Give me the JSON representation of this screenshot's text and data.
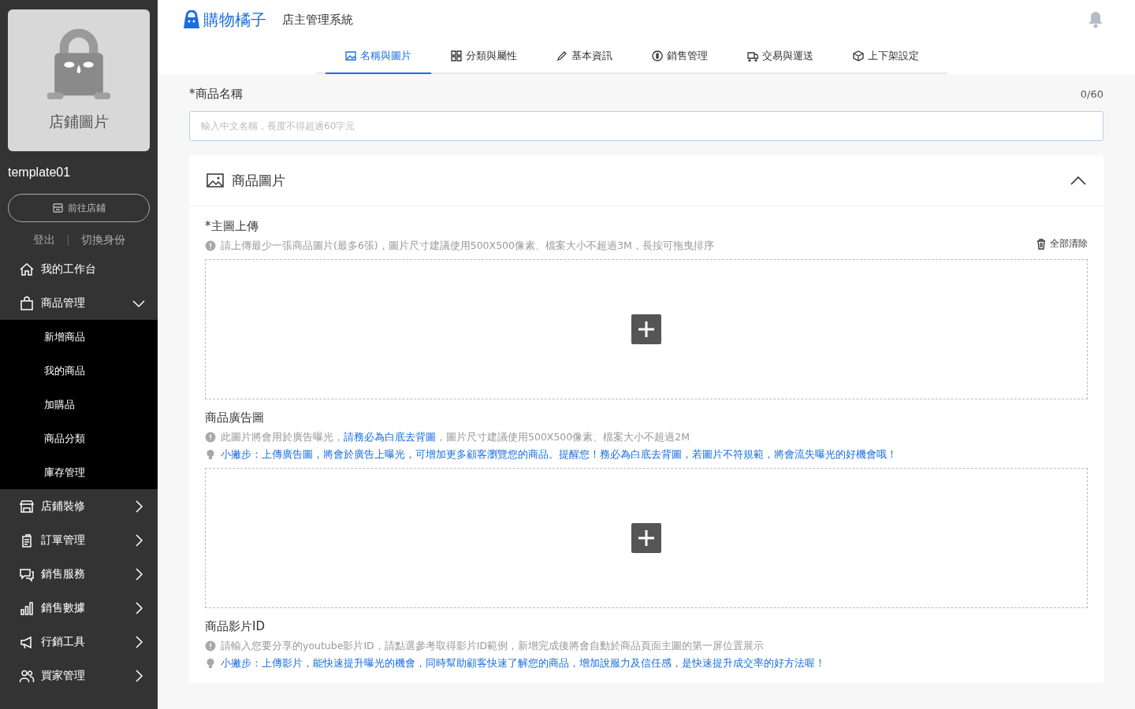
{
  "sidebar": {
    "store_image_label": "店鋪圖片",
    "store_name": "template01",
    "visit_store_button": "前往店鋪",
    "links": [
      "登出",
      "切換身份"
    ],
    "menu": [
      {
        "label": "我的工作台"
      },
      {
        "label": "商品管理",
        "expanded": true,
        "children": [
          {
            "label": "新增商品"
          },
          {
            "label": "我的商品"
          },
          {
            "label": "加購品"
          },
          {
            "label": "商品分類"
          },
          {
            "label": "庫存管理"
          }
        ]
      },
      {
        "label": "店鋪裝修",
        "expanded": false
      },
      {
        "label": "訂單管理",
        "expanded": false
      },
      {
        "label": "銷售服務",
        "expanded": false
      },
      {
        "label": "銷售數據",
        "expanded": false
      },
      {
        "label": "行銷工具",
        "expanded": false
      },
      {
        "label": "買家管理",
        "expanded": false
      }
    ]
  },
  "header": {
    "logo_text": "購物橘子",
    "system_name": "店主管理系統"
  },
  "tabs": [
    {
      "label": "名稱與圖片",
      "selected": true
    },
    {
      "label": "分類與屬性",
      "selected": false
    },
    {
      "label": "基本資訊",
      "selected": false
    },
    {
      "label": "銷售管理",
      "selected": false
    },
    {
      "label": "交易與運送",
      "selected": false
    },
    {
      "label": "上下架設定",
      "selected": false
    }
  ],
  "product_name": {
    "label": "*商品名稱",
    "counter": "0/60",
    "placeholder": "輸入中文名稱，長度不得超過60字元"
  },
  "image_section": {
    "title": "商品圖片",
    "expanded": true,
    "blocks": [
      {
        "title": "*主圖上傳",
        "clear_button": "全部清除",
        "kind": "upload",
        "notes": [
          {
            "kind": "info",
            "text": "請上傳最少一張商品圖片(最多6張)，圖片尺寸建議使用500X500像素、檔案大小不超過3M，長按可拖曳排序"
          }
        ]
      },
      {
        "title": "商品廣告圖",
        "kind": "upload",
        "notes": [
          {
            "kind": "info",
            "text": "此圖片將會用於廣告曝光，**請務必為白底去背圖**，圖片尺寸建議使用500X500像素、檔案大小不超過2M"
          },
          {
            "kind": "tip",
            "text": "小撇步：上傳廣告圖，將會於廣告上曝光，可增加更多顧客瀏覽您的商品。提醒您！務必為白底去背圖，若圖片不符規範，將會流失曝光的好機會哦！"
          }
        ]
      },
      {
        "title": "商品影片ID",
        "kind": "text",
        "notes": [
          {
            "kind": "info",
            "text": "請輸入您要分享的youtube影片ID，請點選參考取得影片ID範例，新增完成後將會自動於商品頁面主圖的第一屏位置展示"
          },
          {
            "kind": "tip",
            "text": "小撇步：上傳影片，能快速提升曝光的機會，同時幫助顧客快速了解您的商品，增加說服力及信任感，是快速提升成交率的好方法喔！"
          }
        ]
      }
    ]
  }
}
